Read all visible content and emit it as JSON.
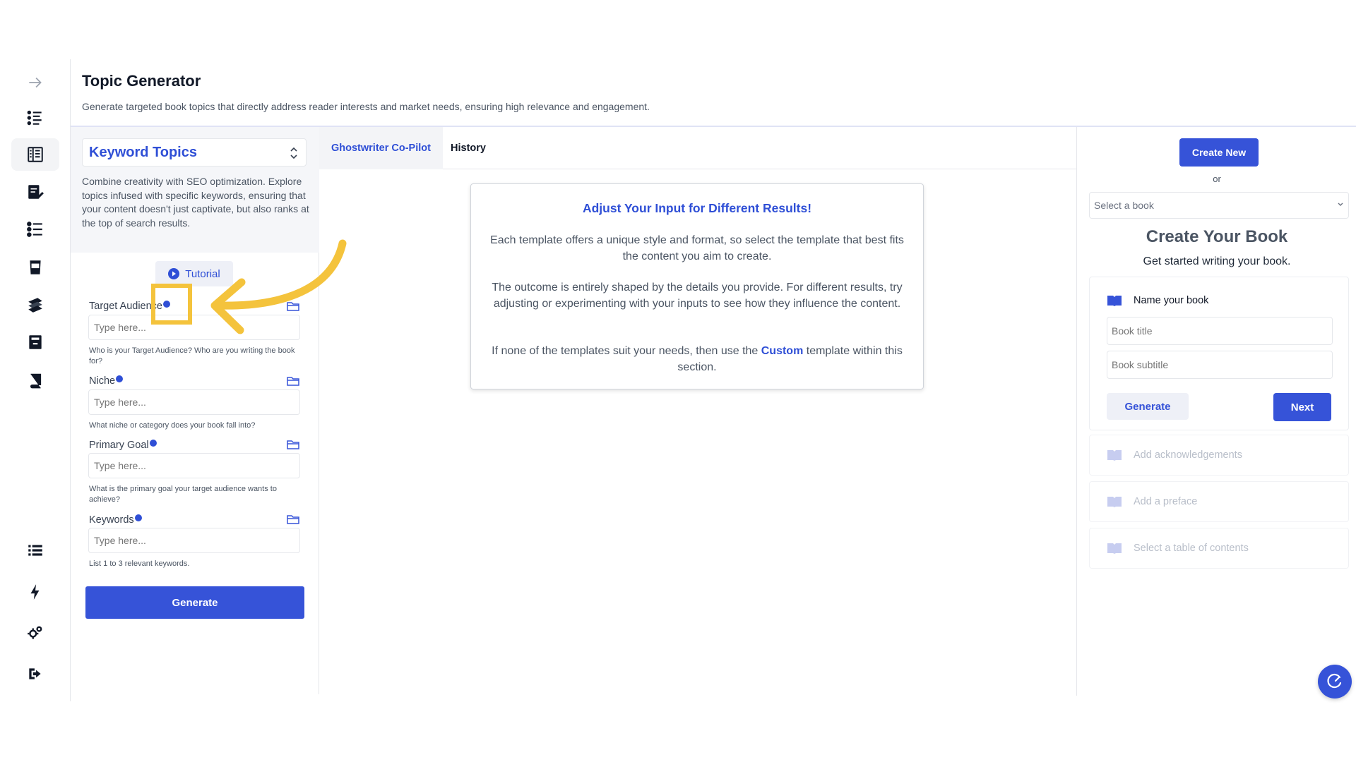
{
  "header": {
    "title": "Topic Generator",
    "description": "Generate targeted book topics that directly address reader interests and market needs, ensuring high relevance and engagement."
  },
  "rail": {
    "icons": [
      "arrow-right-icon",
      "numbered-list-icon",
      "book-layout-icon",
      "book-edit-icon",
      "checklist-icon",
      "cup-icon",
      "books-stack-icon",
      "archive-icon",
      "book-icon",
      "list-icon",
      "lightning-icon",
      "gears-icon",
      "logout-icon"
    ],
    "active_index": 2
  },
  "form": {
    "topic_select": "Keyword Topics",
    "topic_description": "Combine creativity with SEO optimization. Explore topics infused with specific keywords, ensuring that your content doesn't just captivate, but also ranks at the top of search results.",
    "tutorial_label": "Tutorial",
    "fields": [
      {
        "label": "Target Audience",
        "placeholder": "Type here...",
        "help": "Who is your Target Audience? Who are you writing the book for?"
      },
      {
        "label": "Niche",
        "placeholder": "Type here...",
        "help": "What niche or category does your book fall into?"
      },
      {
        "label": "Primary Goal",
        "placeholder": "Type here...",
        "help": "What is the primary goal your target audience wants to achieve?"
      },
      {
        "label": "Keywords",
        "placeholder": "Type here...",
        "help": "List 1 to 3 relevant keywords."
      }
    ],
    "generate_label": "Generate"
  },
  "tabs": [
    {
      "label": "Ghostwriter Co-Pilot",
      "active": true
    },
    {
      "label": "History",
      "active": false
    }
  ],
  "info_card": {
    "title": "Adjust Your Input for Different Results!",
    "para1": "Each template offers a unique style and format, so select the template that best fits the content you aim to create.",
    "para2": "The outcome is entirely shaped by the details you provide. For different results, try adjusting or experimenting with your inputs to see how they influence the content.",
    "para3_before": "If none of the templates suit your needs, then use the ",
    "para3_link": "Custom",
    "para3_after": " template within this section."
  },
  "right": {
    "create_new_label": "Create New",
    "or_text": "or",
    "select_book_placeholder": "Select a book",
    "title": "Create Your Book",
    "subtitle": "Get started writing your book.",
    "step1_label": "Name your book",
    "book_title_placeholder": "Book title",
    "book_subtitle_placeholder": "Book subtitle",
    "generate_label": "Generate",
    "next_label": "Next",
    "steps": [
      "Add acknowledgements",
      "Add a preface",
      "Select a table of contents"
    ]
  },
  "colors": {
    "accent": "#3653d8",
    "highlight": "#f4c33c"
  }
}
